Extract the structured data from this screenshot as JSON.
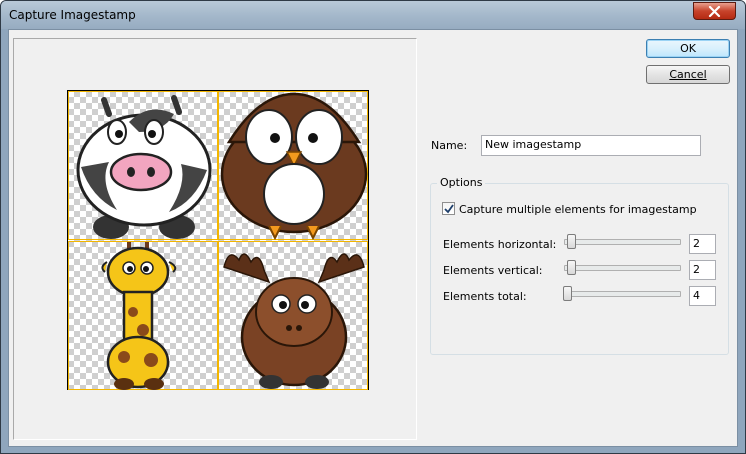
{
  "window": {
    "title": "Capture Imagestamp"
  },
  "buttons": {
    "ok": "OK",
    "cancel": "Cancel"
  },
  "name_field": {
    "label": "Name:",
    "value": "New imagestamp"
  },
  "options": {
    "group_title": "Options",
    "capture_multiple": {
      "label": "Capture multiple elements for imagestamp",
      "checked": true
    },
    "sliders": [
      {
        "label": "Elements horizontal:",
        "value": "2"
      },
      {
        "label": "Elements vertical:",
        "value": "2"
      },
      {
        "label": "Elements total:",
        "value": "4"
      }
    ]
  },
  "preview": {
    "grid": {
      "columns": 2,
      "rows": 2
    },
    "cells": [
      "cow",
      "owl",
      "giraffe",
      "moose"
    ],
    "grid_color": "#f3b600"
  }
}
